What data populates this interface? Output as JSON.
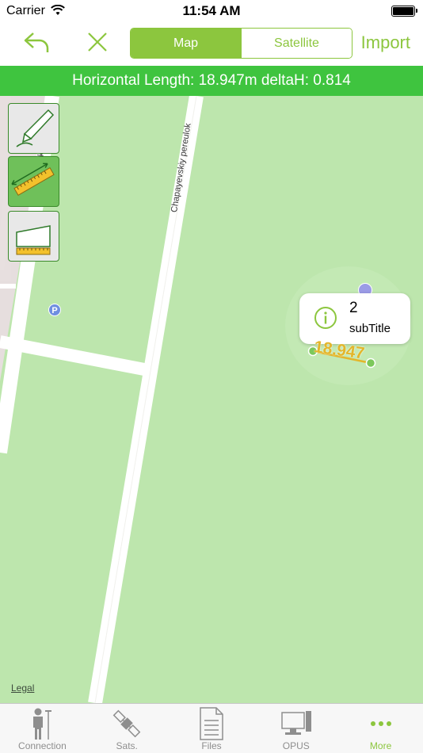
{
  "status_bar": {
    "carrier": "Carrier",
    "time": "11:54 AM"
  },
  "nav": {
    "undo_icon": "undo-arrow-icon",
    "close_icon": "close-x-icon",
    "segments": [
      {
        "label": "Map",
        "selected": true
      },
      {
        "label": "Satellite",
        "selected": false
      }
    ],
    "import_label": "Import"
  },
  "banner": {
    "text": "Horizontal Length: 18.947m deltaH: 0.814",
    "color": "#3fc43f"
  },
  "map": {
    "streets": [
      "Chapayevskiy pereulok",
      "Chapayevskiy pereulok"
    ],
    "parking_symbol": "P",
    "legal_label": "Legal",
    "tools": [
      {
        "name": "freehand-tool",
        "icon": "pencil-icon",
        "selected": false
      },
      {
        "name": "length-tool",
        "icon": "ruler-icon",
        "selected": true
      },
      {
        "name": "area-tool",
        "icon": "area-ruler-icon",
        "selected": false
      }
    ],
    "callout": {
      "title": "2",
      "subtitle": "subTitle"
    },
    "measurement_label": "18.947"
  },
  "tabs": [
    {
      "label": "Connection",
      "icon": "surveyor-icon",
      "active": false
    },
    {
      "label": "Sats.",
      "icon": "satellite-icon",
      "active": false
    },
    {
      "label": "Files",
      "icon": "document-icon",
      "active": false
    },
    {
      "label": "OPUS",
      "icon": "computer-icon",
      "active": false
    },
    {
      "label": "More",
      "icon": "more-dots-icon",
      "active": true
    }
  ],
  "colors": {
    "accent": "#8cc63e",
    "map_bg": "#bde6ad",
    "measure": "#e3b62b"
  }
}
